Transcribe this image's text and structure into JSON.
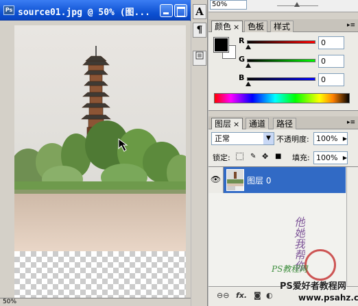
{
  "document": {
    "title": "source01.jpg @ 50% (图...",
    "ps_badge": "Ps",
    "zoom": "50%"
  },
  "mini_tools": {
    "character_glyph": "A",
    "paragraph_glyph": "¶"
  },
  "top_strip": {
    "opacity_value": "50%"
  },
  "color_panel": {
    "tabs": [
      {
        "label": "颜色",
        "close": "×"
      },
      {
        "label": "色板"
      },
      {
        "label": "样式"
      }
    ],
    "menu_glyph": "▸≡",
    "channels": [
      {
        "label": "R",
        "value": "0",
        "color": "#cc0000"
      },
      {
        "label": "G",
        "value": "0",
        "color": "#00aa00"
      },
      {
        "label": "B",
        "value": "0",
        "color": "#0000cc"
      }
    ],
    "foreground_color": "#000000",
    "background_color": "#ffffff"
  },
  "layers_panel": {
    "tabs": [
      {
        "label": "图层",
        "close": "×"
      },
      {
        "label": "通道"
      },
      {
        "label": "路径"
      }
    ],
    "menu_glyph": "▸≡",
    "blend_mode": "正常",
    "opacity_label": "不透明度:",
    "opacity_value": "100%",
    "lock_label": "锁定:",
    "fill_label": "填充:",
    "fill_value": "100%",
    "layer_name": "图层 0",
    "calligraphy": "他她我帮你",
    "watermark_text": "PS教程网",
    "footer_icons": [
      "link-icon",
      "fx-icon",
      "mask-icon",
      "adjustment-icon",
      "group-icon",
      "new-layer-icon",
      "trash-icon"
    ],
    "footer_fx": "fx.",
    "site_logo": "PS爱好者教程网",
    "site_url": "www.psahz.com"
  },
  "colors": {
    "titlebar_blue": "#0b4fd0",
    "selection_blue": "#316ac5",
    "panel_bg": "#ecebe6"
  }
}
